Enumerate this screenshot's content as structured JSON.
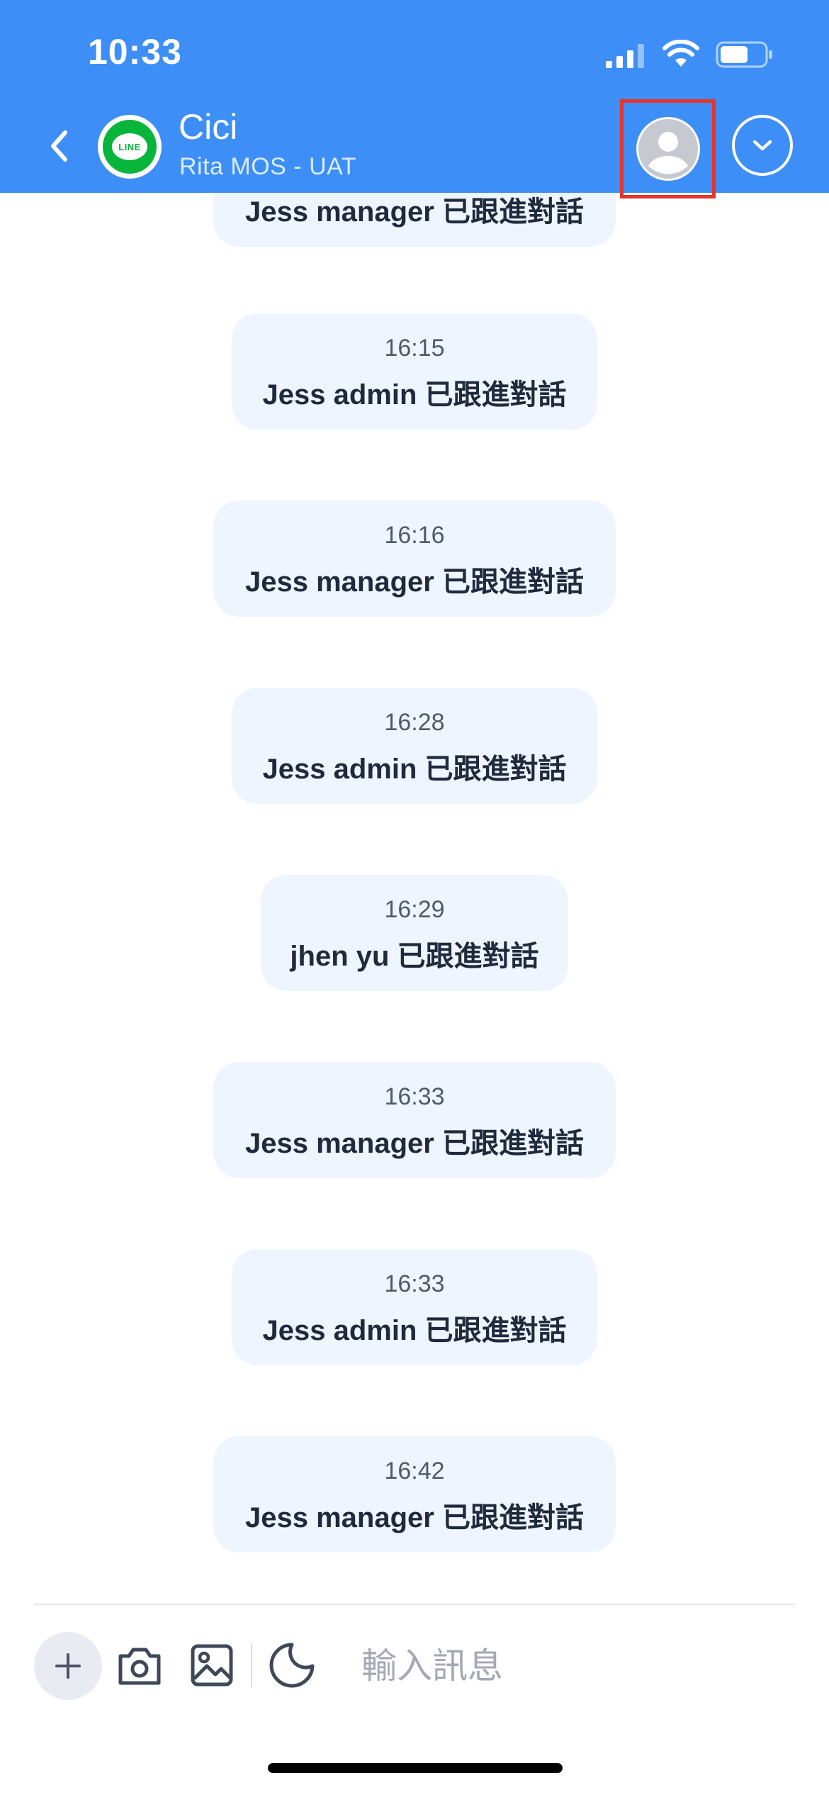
{
  "status_bar": {
    "time": "10:33"
  },
  "header": {
    "name": "Cici",
    "subtitle": "Rita MOS - UAT",
    "channel_logo_text": "LINE",
    "background_color": "#3d8ef7",
    "highlight_color": "#e5362c"
  },
  "messages": [
    {
      "time": "",
      "text": "Jess manager 已跟進對話"
    },
    {
      "time": "16:15",
      "text": "Jess admin 已跟進對話"
    },
    {
      "time": "16:16",
      "text": "Jess manager 已跟進對話"
    },
    {
      "time": "16:28",
      "text": "Jess admin 已跟進對話"
    },
    {
      "time": "16:29",
      "text": "jhen yu 已跟進對話"
    },
    {
      "time": "16:33",
      "text": "Jess manager 已跟進對話"
    },
    {
      "time": "16:33",
      "text": "Jess admin 已跟進對話"
    },
    {
      "time": "16:42",
      "text": "Jess manager 已跟進對話"
    }
  ],
  "input_bar": {
    "placeholder": "輸入訊息",
    "icons": [
      "plus-icon",
      "camera-icon",
      "image-icon",
      "sticker-icon"
    ]
  },
  "icons": {
    "back": "chevron-left-icon",
    "profile": "user-avatar-icon",
    "dropdown": "chevron-down-icon"
  }
}
